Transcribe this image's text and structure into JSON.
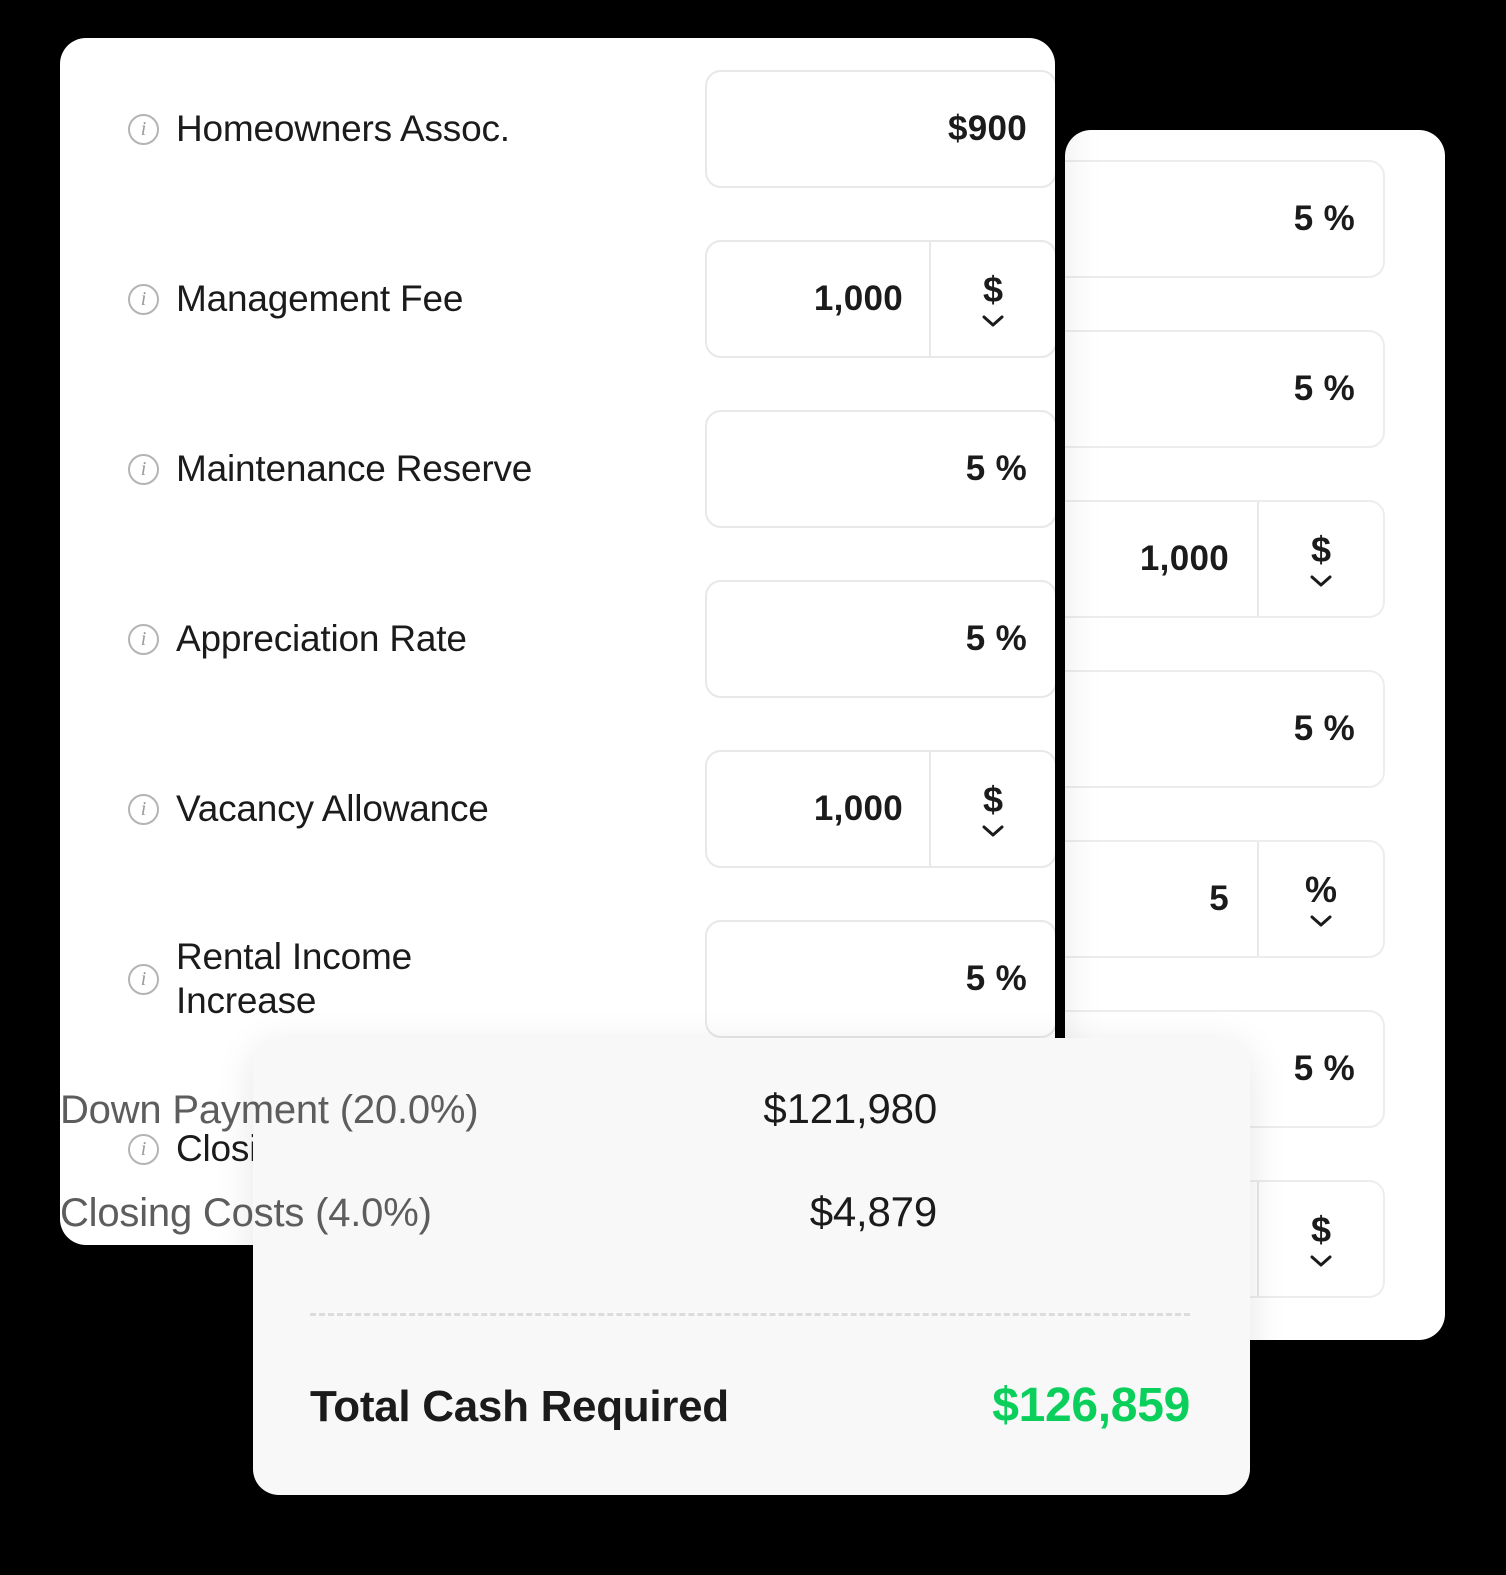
{
  "colors": {
    "accent_green": "#0ACF5B",
    "card_bg": "#FFFFFF",
    "summary_bg": "#F8F8F8",
    "text_dark": "#1B1B1B",
    "text_muted": "#5D5D5D",
    "border": "#E8E8E8",
    "page_bg": "#000000"
  },
  "front_card": {
    "rows": [
      {
        "label": "Homeowners Assoc.",
        "icon": "info-circle-icon",
        "value": "$900",
        "has_unit": false,
        "unit": "",
        "unit_icon": ""
      },
      {
        "label": "Management Fee",
        "icon": "info-circle-icon",
        "value": "1,000",
        "has_unit": true,
        "unit": "$",
        "unit_icon": "chevron-down-icon"
      },
      {
        "label": "Maintenance Reserve",
        "icon": "info-circle-icon",
        "value": "5 %",
        "has_unit": false,
        "unit": "",
        "unit_icon": ""
      },
      {
        "label": "Appreciation Rate",
        "icon": "info-circle-icon",
        "value": "5 %",
        "has_unit": false,
        "unit": "",
        "unit_icon": ""
      },
      {
        "label": "Vacancy Allowance",
        "icon": "info-circle-icon",
        "value": "1,000",
        "has_unit": true,
        "unit": "$",
        "unit_icon": "chevron-down-icon"
      },
      {
        "label": "Rental Income\nIncrease",
        "icon": "info-circle-icon",
        "value": "5 %",
        "has_unit": false,
        "unit": "",
        "unit_icon": ""
      },
      {
        "label": "Closing Costs",
        "icon": "info-circle-icon",
        "value": "",
        "has_unit": false,
        "unit": "",
        "unit_icon": ""
      }
    ]
  },
  "back_card": {
    "rows": [
      {
        "value": "5 %",
        "has_unit": false,
        "unit": "",
        "unit_icon": ""
      },
      {
        "value": "5 %",
        "has_unit": false,
        "unit": "",
        "unit_icon": ""
      },
      {
        "value": "1,000",
        "has_unit": true,
        "unit": "$",
        "unit_icon": "chevron-down-icon"
      },
      {
        "value": "5 %",
        "has_unit": false,
        "unit": "",
        "unit_icon": ""
      },
      {
        "value": "5",
        "has_unit": true,
        "unit": "%",
        "unit_icon": "chevron-down-icon"
      },
      {
        "value": "5 %",
        "has_unit": false,
        "unit": "",
        "unit_icon": ""
      },
      {
        "value": "",
        "has_unit": true,
        "unit": "$",
        "unit_icon": "chevron-down-icon"
      }
    ]
  },
  "summary_card": {
    "lines": [
      {
        "label": "Down Payment (20.0%)",
        "value": "$121,980"
      },
      {
        "label": "Closing Costs (4.0%)",
        "value": "$4,879"
      }
    ],
    "total_label": "Total Cash Required",
    "total_value": "$126,859"
  }
}
